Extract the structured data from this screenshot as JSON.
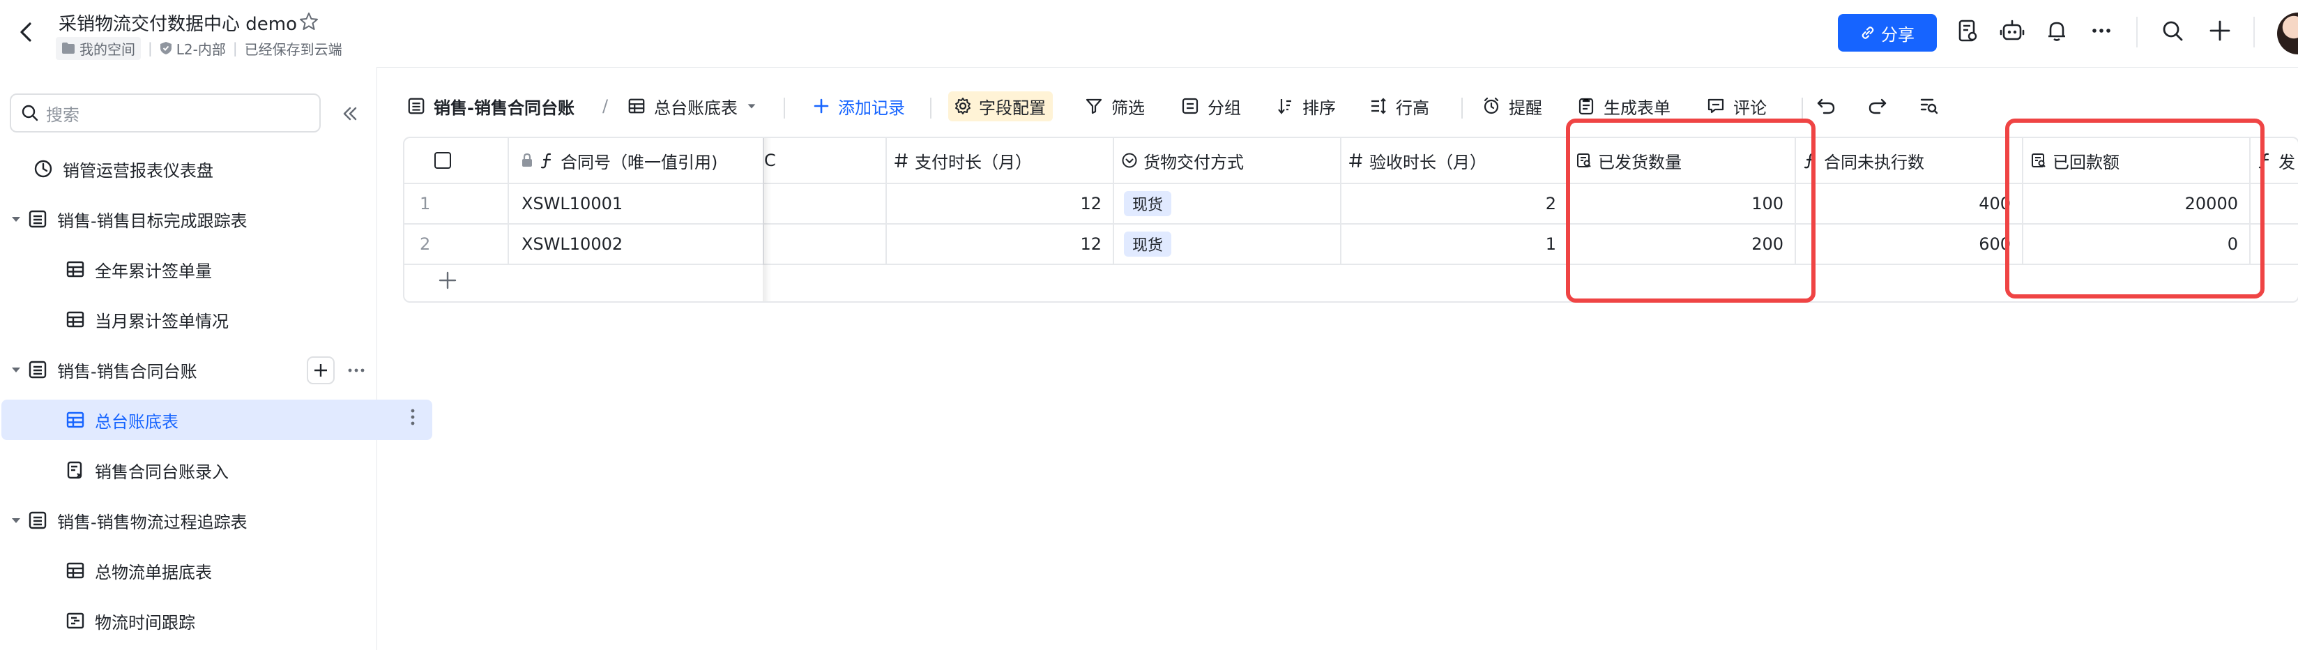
{
  "header": {
    "title": "采销物流交付数据中心 demo",
    "breadcrumb": {
      "space": "我的空间",
      "security": "L2-内部",
      "save_status": "已经保存到云端"
    },
    "share_label": "分享"
  },
  "sidebar": {
    "search_placeholder": "搜索",
    "items": [
      {
        "label": "销管运营报表仪表盘"
      },
      {
        "label": "销售-销售目标完成跟踪表"
      },
      {
        "label": "全年累计签单量"
      },
      {
        "label": "当月累计签单情况"
      },
      {
        "label": "销售-销售合同台账"
      },
      {
        "label": "总台账底表"
      },
      {
        "label": "销售合同台账录入"
      },
      {
        "label": "销售-销售物流过程追踪表"
      },
      {
        "label": "总物流单据底表"
      },
      {
        "label": "物流时间跟踪"
      }
    ]
  },
  "toolbar": {
    "table_name": "销售-销售合同台账",
    "separator": "/",
    "view_name": "总台账底表",
    "add_record": "添加记录",
    "field_config": "字段配置",
    "filter": "筛选",
    "group": "分组",
    "sort": "排序",
    "row_height": "行高",
    "remind": "提醒",
    "generate_form": "生成表单",
    "comment": "评论"
  },
  "table": {
    "columns": {
      "contract_no": "合同号（唯一值引用)",
      "partial": "C",
      "payment_period": "支付时长（月）",
      "delivery_method": "货物交付方式",
      "acceptance_period": "验收时长（月）",
      "shipped_qty": "已发货数量",
      "unexecuted": "合同未执行数",
      "received_amount": "已回款额",
      "next": "发"
    },
    "rows": [
      {
        "idx": "1",
        "contract_no": "XSWL10001",
        "payment_period": "12",
        "delivery_method": "现货",
        "acceptance_period": "2",
        "shipped_qty": "100",
        "unexecuted": "400",
        "received_amount": "20000"
      },
      {
        "idx": "2",
        "contract_no": "XSWL10002",
        "payment_period": "12",
        "delivery_method": "现货",
        "acceptance_period": "1",
        "shipped_qty": "200",
        "unexecuted": "600",
        "received_amount": "0"
      }
    ]
  },
  "colors": {
    "accent": "#1664ff",
    "highlight": "#ef4444",
    "active_bg": "#e1eaff"
  }
}
